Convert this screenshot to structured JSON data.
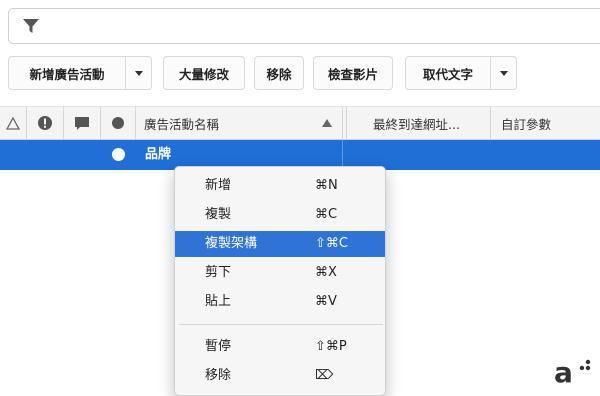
{
  "toolbar": {
    "new_campaign": "新增廣告活動",
    "bulk_edit": "大量修改",
    "remove": "移除",
    "check_video": "檢查影片",
    "replace_text": "取代文字"
  },
  "table": {
    "columns": {
      "campaign_name": "廣告活動名稱",
      "final_url": "最終到達網址...",
      "custom_params": "自訂參數"
    },
    "selected_row": {
      "name": "品牌"
    }
  },
  "context_menu": {
    "items": [
      {
        "label": "新增",
        "shortcut": "⌘N"
      },
      {
        "label": "複製",
        "shortcut": "⌘C"
      },
      {
        "label": "複製架構",
        "shortcut": "⇧⌘C"
      },
      {
        "label": "剪下",
        "shortcut": "⌘X"
      },
      {
        "label": "貼上",
        "shortcut": "⌘V"
      },
      {
        "label": "暫停",
        "shortcut": "⇧⌘P"
      },
      {
        "label": "移除",
        "shortcut": "⌦"
      }
    ],
    "highlighted_index": 2
  },
  "watermark": {
    "text": "a"
  },
  "colors": {
    "selection": "#1f6fd6",
    "menu_highlight": "#2f73d6"
  },
  "icons": [
    "filter-icon",
    "warning-triangle-icon",
    "error-icon",
    "comment-icon",
    "status-dot-icon",
    "sort-up-icon",
    "caret-down-icon"
  ]
}
